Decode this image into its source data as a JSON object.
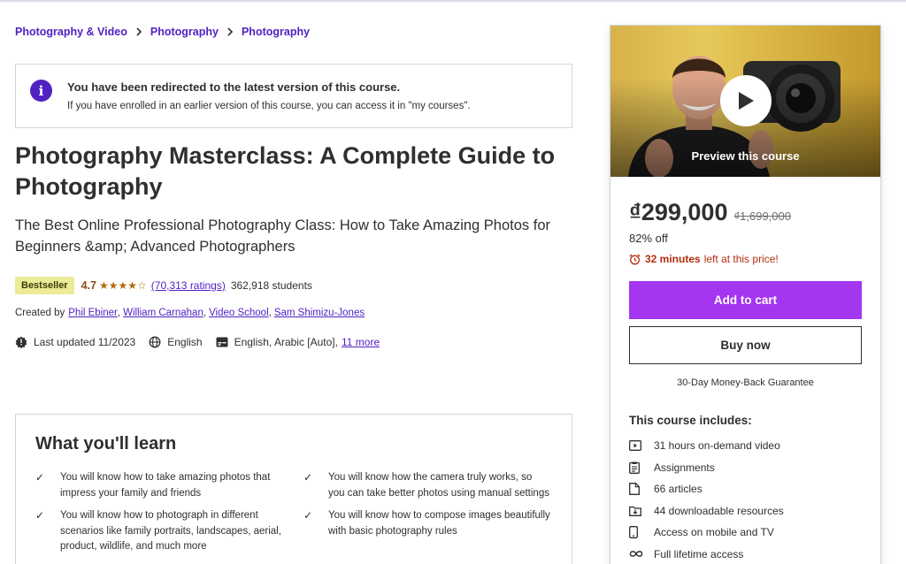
{
  "breadcrumb": [
    "Photography & Video",
    "Photography",
    "Photography"
  ],
  "alert": {
    "title": "You have been redirected to the latest version of this course.",
    "message": "If you have enrolled in an earlier version of this course, you can access it in \"my courses\"."
  },
  "course": {
    "title": "Photography Masterclass: A Complete Guide to Photography",
    "subtitle": "The Best Online Professional Photography Class: How to Take Amazing Photos for Beginners &amp; Advanced Photographers",
    "badge": "Bestseller",
    "rating": "4.7",
    "stars": "★★★★☆",
    "ratings_count": "(70,313 ratings)",
    "students": "362,918 students",
    "created_by_label": "Created by",
    "instructors": [
      "Phil Ebiner",
      "William Carnahan",
      "Video School",
      "Sam Shimizu-Jones"
    ],
    "last_updated": "Last updated 11/2023",
    "language": "English",
    "captions": "English, Arabic [Auto],",
    "captions_more": "11 more"
  },
  "learn": {
    "heading": "What you'll learn",
    "items": [
      "You will know how to take amazing photos that impress your family and friends",
      "You will know how the camera truly works, so you can take better photos using manual settings",
      "You will know how to photograph in different scenarios like family portraits, landscapes, aerial, product, wildlife, and much more",
      "You will know how to compose images beautifully with basic photography rules"
    ]
  },
  "sidebar": {
    "preview_label": "Preview this course",
    "price": "₫299,000",
    "original_price": "₫1,699,000",
    "discount": "82% off",
    "timer_bold": "32 minutes",
    "timer_text": "left at this price!",
    "add_to_cart": "Add to cart",
    "buy_now": "Buy now",
    "guarantee": "30-Day Money-Back Guarantee",
    "includes_title": "This course includes:",
    "includes": [
      {
        "icon": "video-icon",
        "label": "31 hours on-demand video"
      },
      {
        "icon": "assignment-icon",
        "label": "Assignments"
      },
      {
        "icon": "article-icon",
        "label": "66 articles"
      },
      {
        "icon": "download-icon",
        "label": "44 downloadable resources"
      },
      {
        "icon": "mobile-icon",
        "label": "Access on mobile and TV"
      },
      {
        "icon": "infinity-icon",
        "label": "Full lifetime access"
      }
    ]
  },
  "colors": {
    "brand_purple": "#5022c3",
    "cart_button": "#a435f0",
    "timer_red": "#b32d0f",
    "badge_bg": "#eceb98"
  }
}
